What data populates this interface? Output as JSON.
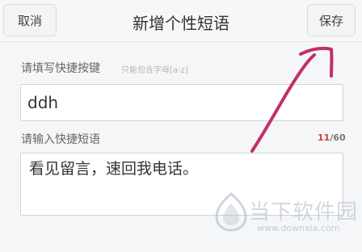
{
  "header": {
    "cancel_label": "取消",
    "title": "新增个性短语",
    "save_label": "保存"
  },
  "shortcut_key": {
    "label": "请填写快捷按键",
    "hint": "只能包含字母[a-z]",
    "value": "ddh"
  },
  "phrase": {
    "label": "请输入快捷短语",
    "value": "看见留言，速回我电话。",
    "count_current": "11",
    "count_max": "/60"
  },
  "watermark": {
    "brand": "当下软件园",
    "url": "www.downxia.com",
    "logo_icon": "downxia-logo-icon"
  },
  "annotation": {
    "stroke_color": "#c0306a",
    "icon": "handwritten-arrow-icon"
  }
}
